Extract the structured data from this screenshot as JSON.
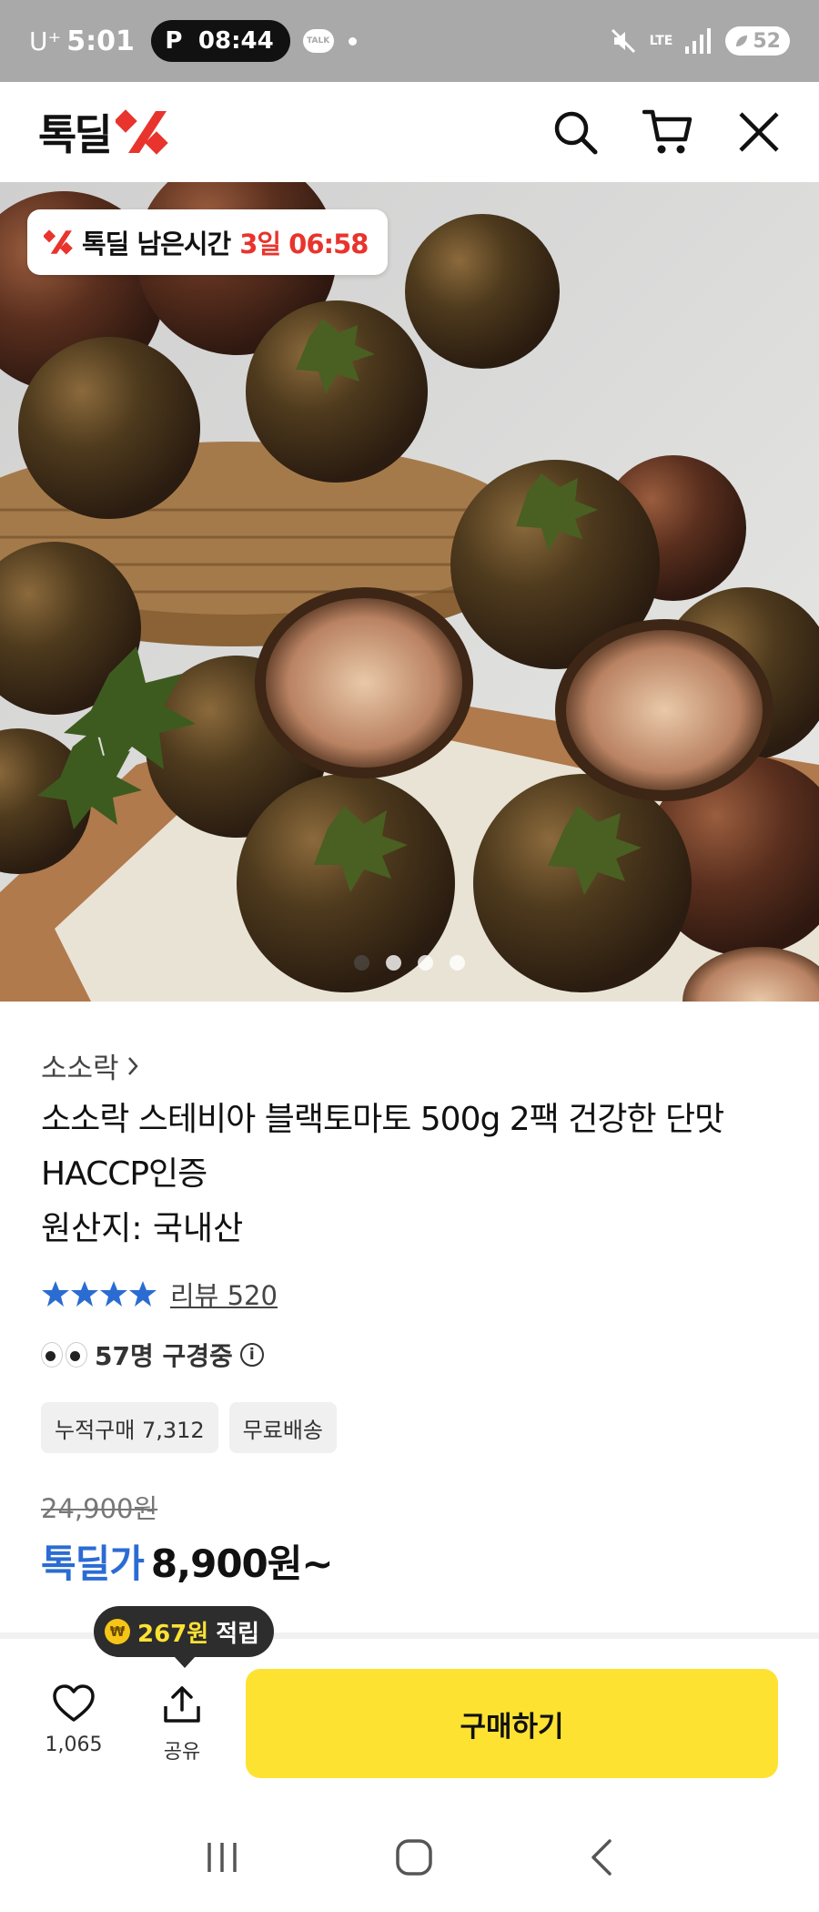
{
  "status_bar": {
    "carrier": "U⁺",
    "time": "5:01",
    "pill_icon": "P",
    "pill_time": "08:44",
    "talk_label": "TALK",
    "network": "LTE",
    "battery": "52"
  },
  "app_bar": {
    "logo_text": "톡딜",
    "icons": [
      "search-icon",
      "cart-icon",
      "close-icon"
    ]
  },
  "hero": {
    "timer_label": "톡딜 남은시간",
    "timer_time": "3일 06:58",
    "carousel_count": 4,
    "carousel_active_index": 0
  },
  "product": {
    "brand": "소소락",
    "title": "소소락 스테비아 블랙토마토 500g 2팩 건강한 단맛 HACCP인증",
    "origin": "원산지: 국내산",
    "rating_stars": 4,
    "review_label": "리뷰 520",
    "viewers_text": "57명 구경중",
    "tags": [
      "누적구매 7,312",
      "무료배송"
    ],
    "original_price": "24,900원",
    "price_label": "톡딜가",
    "price": "8,900원~"
  },
  "bottom_bar": {
    "points_amount": "267원",
    "points_label": "적립",
    "like_count": "1,065",
    "share_label": "공유",
    "buy_label": "구매하기"
  },
  "nav": {
    "icons": [
      "recent-apps-icon",
      "home-icon",
      "back-icon"
    ]
  },
  "colors": {
    "accent_red": "#e8342d",
    "price_blue": "#2b6cd3",
    "buy_yellow": "#fde232",
    "star_blue": "#2b6cd3"
  }
}
